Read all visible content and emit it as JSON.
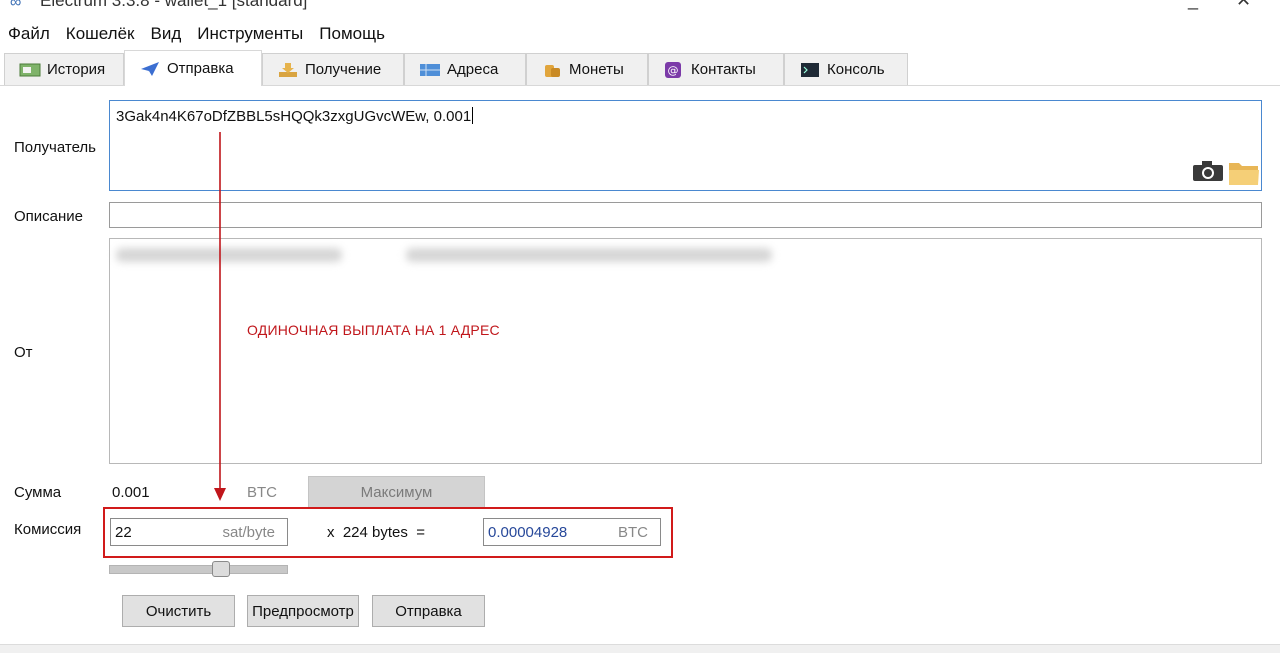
{
  "window": {
    "title": "Electrum 3.3.8 - wallet_1 [standard]"
  },
  "menu": [
    "Файл",
    "Кошелёк",
    "Вид",
    "Инструменты",
    "Помощь"
  ],
  "tabs": [
    {
      "label": "История",
      "icon": "history-icon"
    },
    {
      "label": "Отправка",
      "icon": "send-icon"
    },
    {
      "label": "Получение",
      "icon": "receive-icon"
    },
    {
      "label": "Адреса",
      "icon": "addresses-icon"
    },
    {
      "label": "Монеты",
      "icon": "coins-icon"
    },
    {
      "label": "Контакты",
      "icon": "contacts-icon"
    },
    {
      "label": "Консоль",
      "icon": "console-icon"
    }
  ],
  "send": {
    "recipient_label": "Получатель",
    "recipient_value": "3Gak4n4K67oDfZBBL5sHQQk3zxgUGvcWEw, 0.001",
    "description_label": "Описание",
    "from_label": "От",
    "amount_label": "Сумма",
    "amount_value": "0.001",
    "amount_unit": "BTC",
    "max_button": "Максимум",
    "fee_label": "Комиссия",
    "fee_rate": "22",
    "fee_rate_unit": "sat/byte",
    "fee_multiplier": "x  224 bytes  =",
    "fee_total": "0.00004928",
    "fee_total_unit": "BTC",
    "fee_slider_fraction": 0.64,
    "clear_button": "Очистить",
    "preview_button": "Предпросмотр",
    "send_button": "Отправка"
  },
  "annotation": {
    "text": "ОДИНОЧНАЯ ВЫПЛАТА НА 1 АДРЕС",
    "color": "#c0161b"
  },
  "colors": {
    "highlight_box": "#d11a1a",
    "input_focus": "#4a88d0",
    "fee_value": "#27489a"
  }
}
